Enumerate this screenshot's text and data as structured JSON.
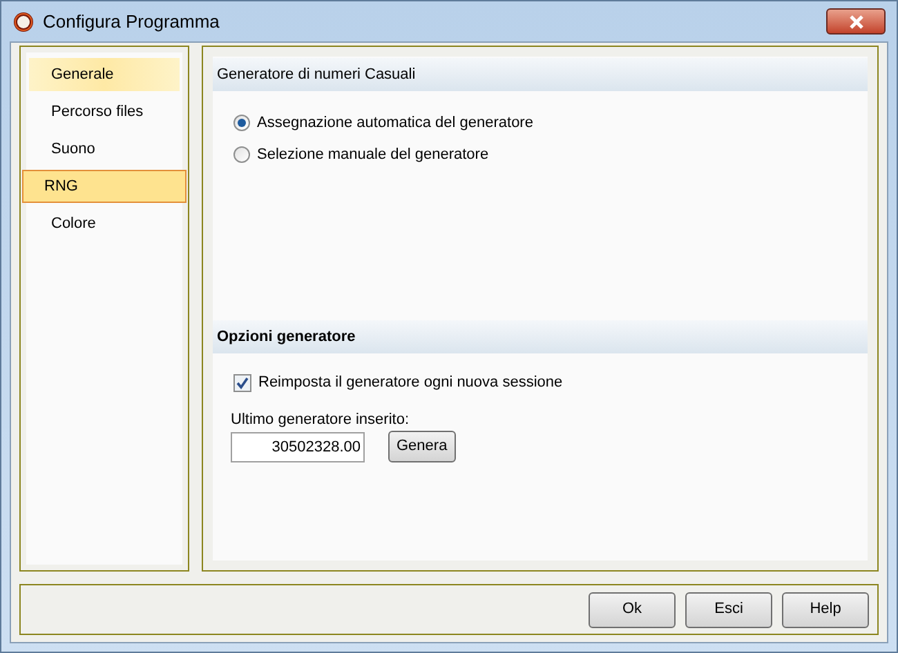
{
  "window": {
    "title": "Configura Programma"
  },
  "sidebar": {
    "items": [
      {
        "label": "Generale",
        "selected": false,
        "highlighted": true
      },
      {
        "label": "Percorso files",
        "selected": false,
        "highlighted": false
      },
      {
        "label": "Suono",
        "selected": false,
        "highlighted": false
      },
      {
        "label": "RNG",
        "selected": true,
        "highlighted": false
      },
      {
        "label": "Colore",
        "selected": false,
        "highlighted": false
      }
    ]
  },
  "sections": [
    {
      "title": "Generatore di numeri Casuali",
      "bold": false,
      "radios": [
        {
          "label": "Assegnazione automatica del generatore",
          "selected": true
        },
        {
          "label": "Selezione manuale del generatore",
          "selected": false
        }
      ]
    },
    {
      "title": "Opzioni generatore",
      "bold": true,
      "checkbox": {
        "label": "Reimposta il generatore ogni nuova sessione",
        "checked": true
      },
      "seed": {
        "label": "Ultimo generatore inserito:",
        "value": "30502328.00",
        "button": "Genera"
      }
    }
  ],
  "buttons": [
    "Ok",
    "Esci",
    "Help"
  ]
}
